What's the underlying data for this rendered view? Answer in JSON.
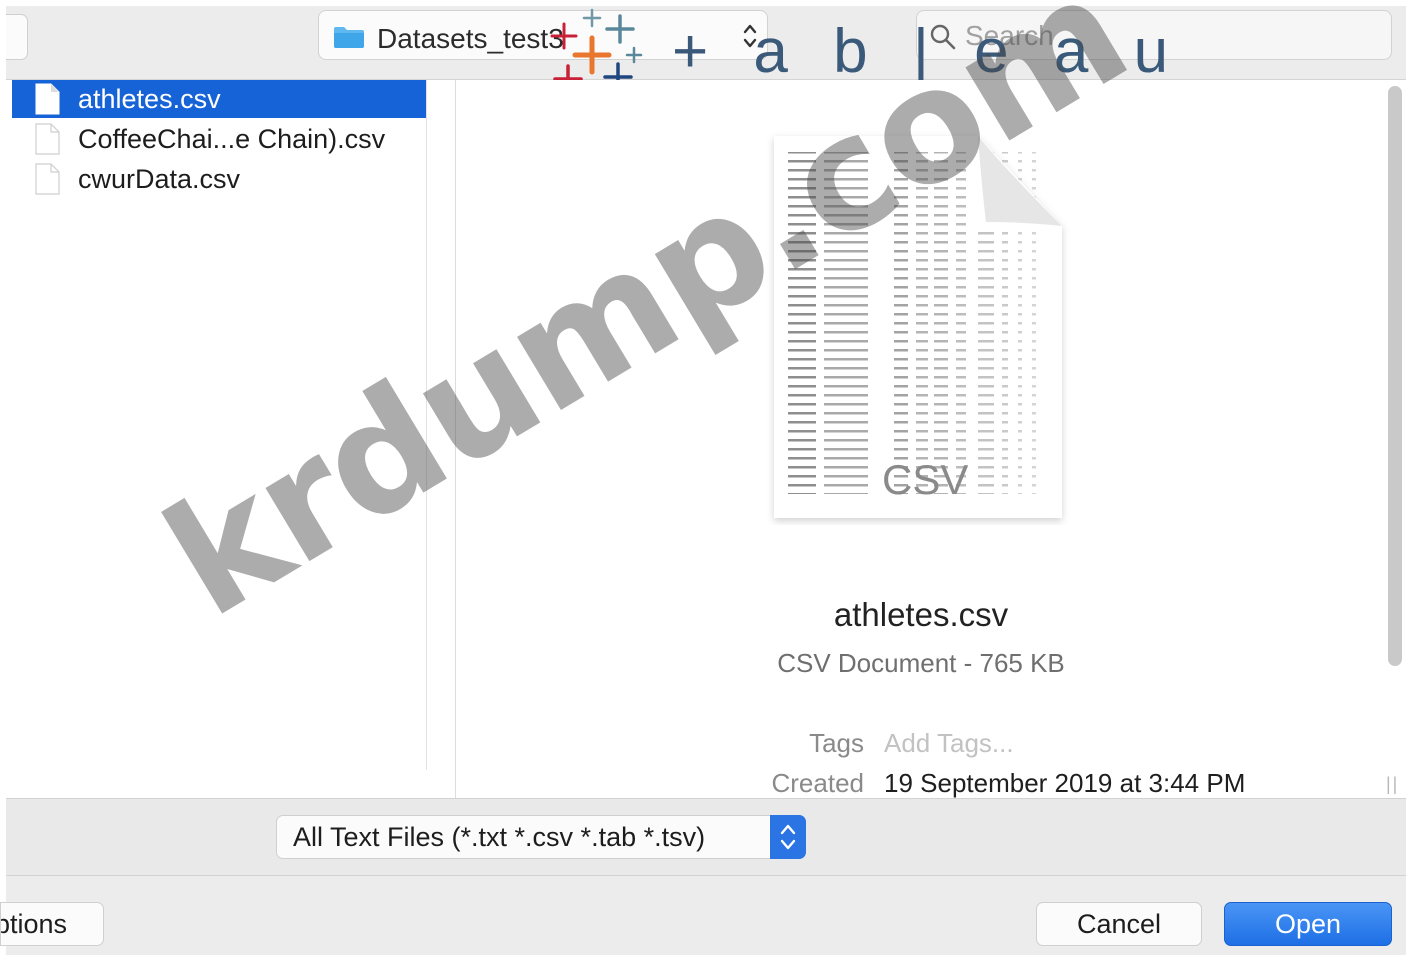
{
  "toolbar": {
    "folder_name": "Datasets_test3",
    "search_placeholder": "Search"
  },
  "logo": {
    "text": "+ a b | e a u",
    "colors": [
      "#e8762c",
      "#5b879b",
      "#c72037",
      "#1f457e",
      "#7099a6"
    ]
  },
  "file_list": {
    "items": [
      {
        "label": "athletes.csv",
        "selected": true
      },
      {
        "label": "CoffeeChai...e Chain).csv",
        "selected": false
      },
      {
        "label": "cwurData.csv",
        "selected": false
      }
    ]
  },
  "preview": {
    "badge": "CSV",
    "file_name": "athletes.csv",
    "kind_size": "CSV Document - 765 KB",
    "tags_label": "Tags",
    "tags_value": "Add Tags...",
    "created_label": "Created",
    "created_value": "19 September 2019 at 3:44 PM"
  },
  "format_bar": {
    "selected_format": "All Text Files (*.txt *.csv *.tab *.tsv)"
  },
  "buttons": {
    "options_label": "Options",
    "cancel_label": "Cancel",
    "open_label": "Open"
  },
  "watermark": {
    "text": "krdump.com"
  },
  "colors": {
    "selection": "#1663d8",
    "accent": "#2a74e3",
    "folder": "#5fb8ef"
  }
}
